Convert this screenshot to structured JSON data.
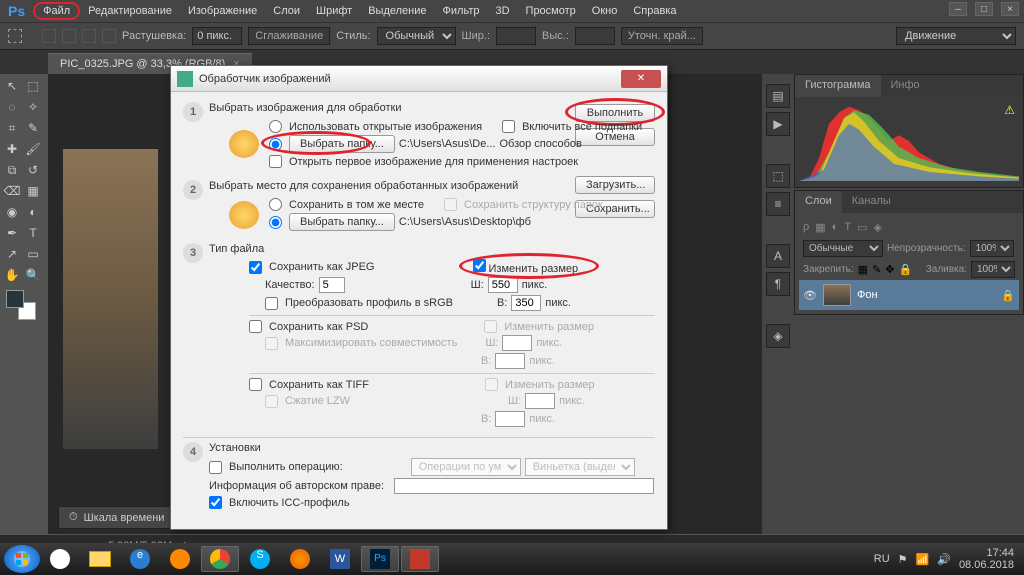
{
  "app": {
    "logo": "Ps"
  },
  "menu": {
    "items": [
      "Файл",
      "Редактирование",
      "Изображение",
      "Слои",
      "Шрифт",
      "Выделение",
      "Фильтр",
      "3D",
      "Просмотр",
      "Окно",
      "Справка"
    ]
  },
  "options": {
    "rast": "Растушевка:",
    "rast_val": "0 пикс.",
    "smooth": "Сглаживание",
    "style_lbl": "Стиль:",
    "style_val": "Обычный",
    "width_lbl": "Шир.:",
    "height_lbl": "Выс.:",
    "refine": "Уточн. край...",
    "workspace": "Движение"
  },
  "doc_tab": "PIC_0325.JPG @ 33,3% (RGB/8)",
  "dialog": {
    "title": "Обработчик изображений",
    "sec1": {
      "title": "Выбрать изображения для обработки",
      "use_open": "Использовать открытые изображения",
      "include_sub": "Включить все подпапки",
      "select_folder": "Выбрать папку...",
      "path": "C:\\Users\\Asus\\De...",
      "browse": "Обзор способов",
      "open_first": "Открыть первое изображение для применения настроек"
    },
    "sec2": {
      "title": "Выбрать место для сохранения обработанных изображений",
      "same_place": "Сохранить в том же месте",
      "keep_struct": "Сохранить структуру папок",
      "select_folder": "Выбрать папку...",
      "path": "C:\\Users\\Asus\\Desktop\\фб"
    },
    "sec3": {
      "title": "Тип файла",
      "save_jpeg": "Сохранить как JPEG",
      "quality": "Качество:",
      "quality_val": "5",
      "resize": "Изменить размер",
      "w": "Ш:",
      "w_val": "550",
      "h": "В:",
      "h_val": "350",
      "px": "пикс.",
      "convert_srgb": "Преобразовать профиль в sRGB",
      "save_psd": "Сохранить как PSD",
      "max_compat": "Максимизировать совместимость",
      "save_tiff": "Сохранить как TIFF",
      "lzw": "Сжатие LZW"
    },
    "sec4": {
      "title": "Установки",
      "run_action": "Выполнить операцию:",
      "action_set": "Операции по умол...",
      "action": "Виньетка (выделен...",
      "copyright": "Информация об авторском праве:",
      "icc": "Включить ICC-профиль"
    },
    "buttons": {
      "run": "Выполнить",
      "cancel": "Отмена",
      "load": "Загрузить...",
      "save": "Сохранить..."
    }
  },
  "panels": {
    "histogram": "Гистограмма",
    "info": "Инфо",
    "layers": "Слои",
    "channels": "Каналы",
    "mode": "Обычные",
    "opacity_lbl": "Непрозрачность:",
    "opacity": "100%",
    "lock_lbl": "Закрепить:",
    "fill_lbl": "Заливка:",
    "fill": "100%",
    "layer_name": "Фон"
  },
  "timeline": "Шкала времени",
  "status": {
    "doc_size": "5,93M/5,93M"
  },
  "tray": {
    "lang": "RU",
    "time": "17:44",
    "date": "08.06.2018"
  }
}
